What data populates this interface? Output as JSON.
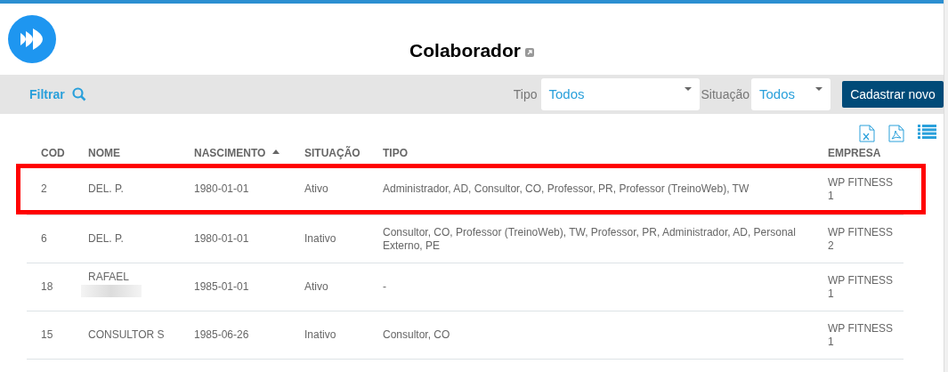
{
  "header": {
    "title": "Colaborador"
  },
  "filter_bar": {
    "filter_label": "Filtrar",
    "tipo_label": "Tipo",
    "tipo_value": "Todos",
    "situacao_label": "Situação",
    "situacao_value": "Todos",
    "new_button": "Cadastrar novo"
  },
  "table": {
    "columns": [
      {
        "label": "COD",
        "sorted": false
      },
      {
        "label": "NOME",
        "sorted": false
      },
      {
        "label": "NASCIMENTO",
        "sorted": true
      },
      {
        "label": "SITUAÇÃO",
        "sorted": false
      },
      {
        "label": "TIPO",
        "sorted": false
      },
      {
        "label": "EMPRESA",
        "sorted": false
      }
    ],
    "rows": [
      {
        "highlighted": true,
        "redacted": false,
        "cells": [
          "2",
          "DEL. P.",
          "1980-01-01",
          "Ativo",
          "Administrador, AD, Consultor, CO, Professor, PR, Professor (TreinoWeb), TW",
          "WP FITNESS 1"
        ]
      },
      {
        "highlighted": false,
        "redacted": false,
        "cells": [
          "6",
          "DEL. P.",
          "1980-01-01",
          "Inativo",
          "Consultor, CO, Professor (TreinoWeb), TW, Professor, PR, Administrador, AD, Personal Externo, PE",
          "WP FITNESS 2"
        ]
      },
      {
        "highlighted": false,
        "redacted": true,
        "cells": [
          "18",
          "RAFAEL",
          "1985-01-01",
          "Ativo",
          "-",
          "WP FITNESS 1"
        ]
      },
      {
        "highlighted": false,
        "redacted": false,
        "cells": [
          "15",
          "CONSULTOR S",
          "1985-06-26",
          "Inativo",
          "Consultor, CO",
          "WP FITNESS 1"
        ]
      }
    ]
  }
}
